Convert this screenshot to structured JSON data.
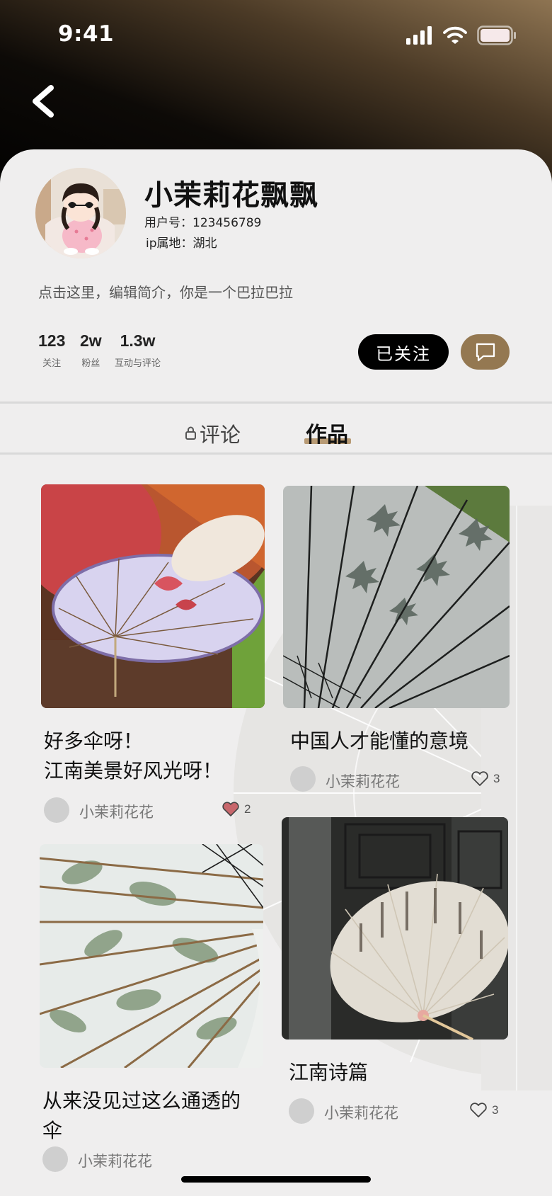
{
  "status_bar": {
    "time": "9:41"
  },
  "profile": {
    "name": "小茉莉花飘飘",
    "user_id_label": "用户号：123456789",
    "ip_label": "ip属地：湖北",
    "bio": "点击这里，编辑简介，你是一个巴拉巴拉"
  },
  "stats": [
    {
      "value": "123",
      "label": "关注"
    },
    {
      "value": "2w",
      "label": "粉丝"
    },
    {
      "value": "1.3w",
      "label": "互动与评论"
    }
  ],
  "actions": {
    "follow_label": "已关注",
    "accent_color": "#947851"
  },
  "tabs": {
    "comments": "评论",
    "works": "作品",
    "active": "works"
  },
  "posts": [
    {
      "title": "好多伞呀！\n江南美景好风光呀！",
      "author": "小茉莉花花",
      "likes": "2",
      "liked": true
    },
    {
      "title": "中国人才能懂的意境",
      "author": "小茉莉花花",
      "likes": "3",
      "liked": false
    },
    {
      "title": "从来没见过这么通透的\n伞",
      "author": "小茉莉花花"
    },
    {
      "title": "江南诗篇",
      "author": "小茉莉花花",
      "likes": "3",
      "liked": false
    }
  ]
}
